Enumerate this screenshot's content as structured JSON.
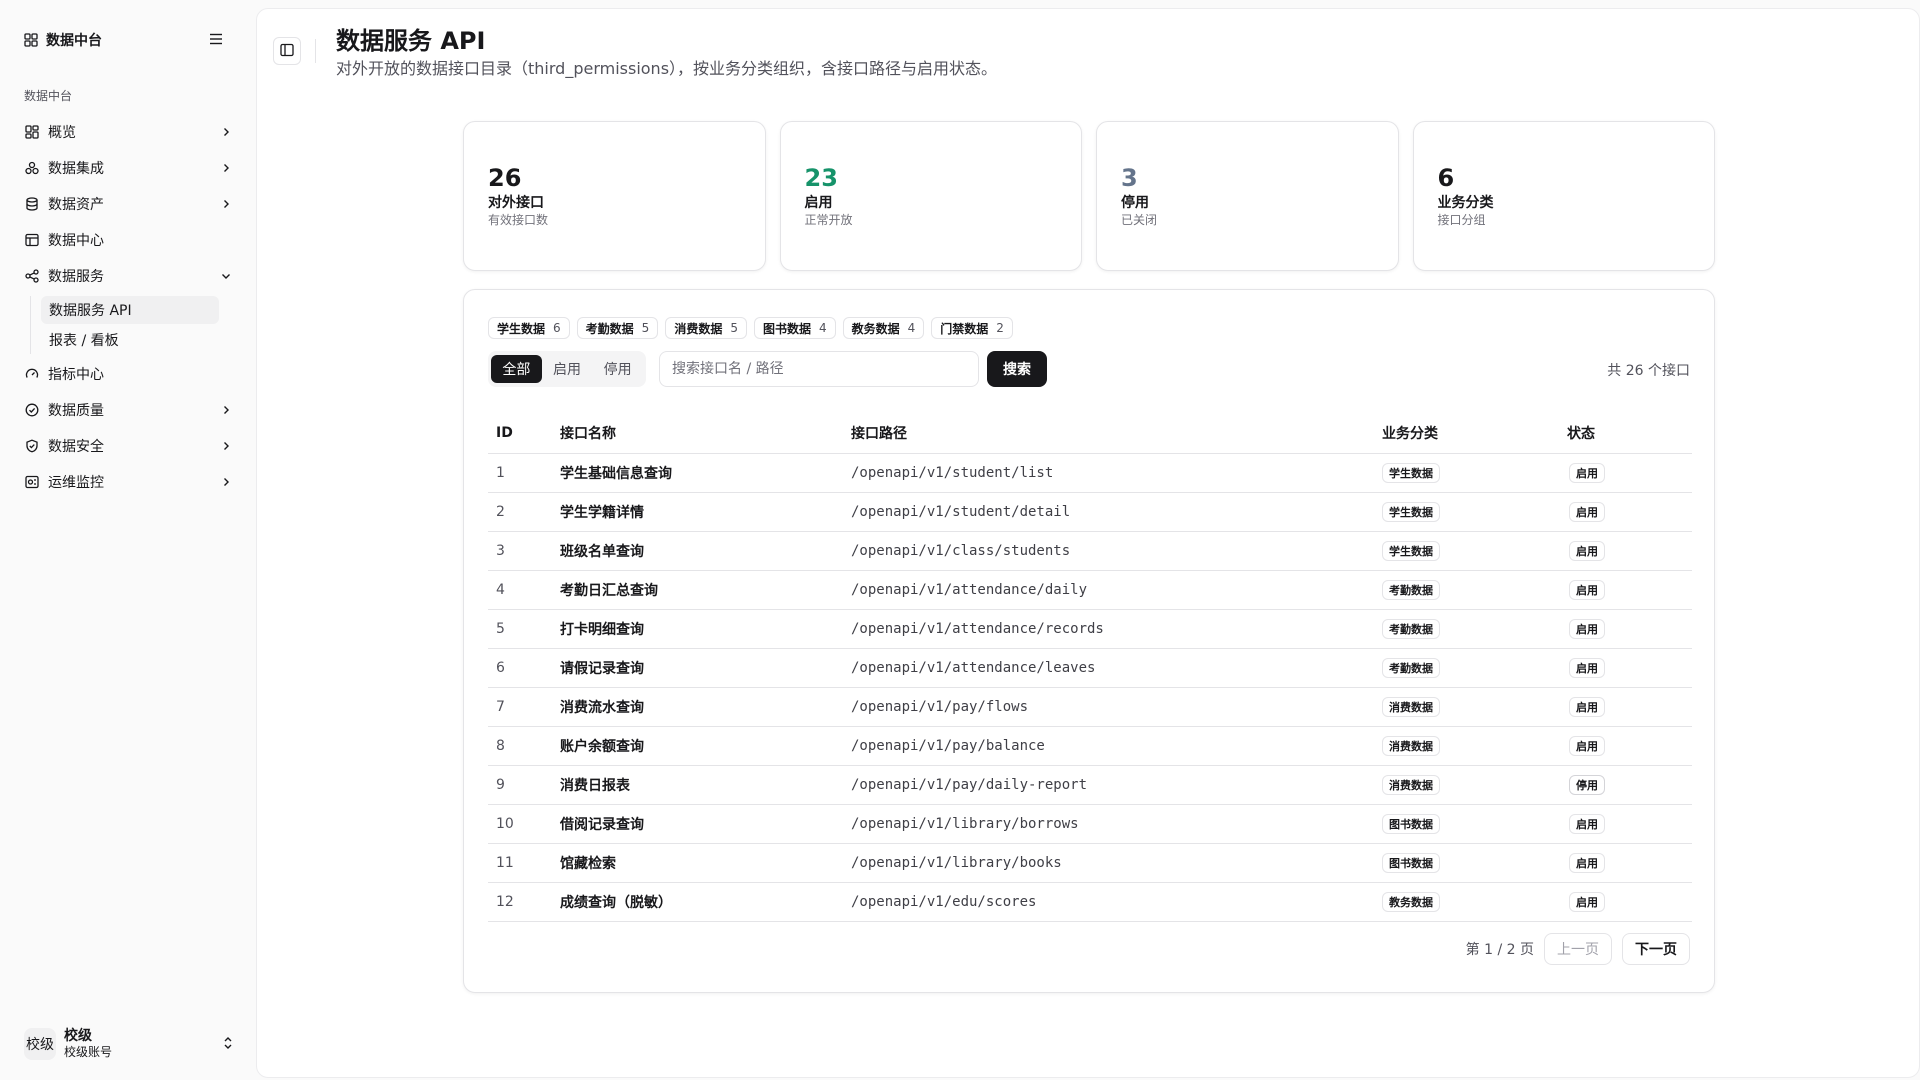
{
  "sidebar": {
    "brand": "数据中台",
    "section_label": "数据中台",
    "items": [
      {
        "label": "概览",
        "icon": "dashboard-icon",
        "has_chevron": true
      },
      {
        "label": "数据集成",
        "icon": "integration-icon",
        "has_chevron": true
      },
      {
        "label": "数据资产",
        "icon": "database-icon",
        "has_chevron": true
      },
      {
        "label": "数据中心",
        "icon": "table-icon",
        "has_chevron": false
      },
      {
        "label": "数据服务",
        "icon": "share-icon",
        "has_chevron": true,
        "expanded": true
      },
      {
        "label": "指标中心",
        "icon": "gauge-icon",
        "has_chevron": false
      },
      {
        "label": "数据质量",
        "icon": "check-circle-icon",
        "has_chevron": true
      },
      {
        "label": "数据安全",
        "icon": "shield-icon",
        "has_chevron": true
      },
      {
        "label": "运维监控",
        "icon": "monitor-icon",
        "has_chevron": true
      }
    ],
    "sub_items": [
      {
        "label": "数据服务 API",
        "active": true
      },
      {
        "label": "报表 / 看板",
        "active": false
      }
    ],
    "user": {
      "avatar": "校级",
      "name": "校级",
      "sub": "校级账号"
    }
  },
  "header": {
    "title": "数据服务 API",
    "description": "对外开放的数据接口目录（third_permissions），按业务分类组织，含接口路径与启用状态。"
  },
  "stats": [
    {
      "value": "26",
      "label": "对外接口",
      "sub": "有效接口数",
      "color": "#18181b"
    },
    {
      "value": "23",
      "label": "启用",
      "sub": "正常开放",
      "color": "#16936a"
    },
    {
      "value": "3",
      "label": "停用",
      "sub": "已关闭",
      "color": "#64748b"
    },
    {
      "value": "6",
      "label": "业务分类",
      "sub": "接口分组",
      "color": "#18181b"
    }
  ],
  "chips": [
    {
      "label": "学生数据",
      "count": "6"
    },
    {
      "label": "考勤数据",
      "count": "5"
    },
    {
      "label": "消费数据",
      "count": "5"
    },
    {
      "label": "图书数据",
      "count": "4"
    },
    {
      "label": "教务数据",
      "count": "4"
    },
    {
      "label": "门禁数据",
      "count": "2"
    }
  ],
  "filter": {
    "segments": [
      "全部",
      "启用",
      "停用"
    ],
    "active_segment": 0,
    "search_placeholder": "搜索接口名 / 路径",
    "search_value": "",
    "search_button": "搜索",
    "total": "共 26 个接口"
  },
  "table": {
    "headers": [
      "ID",
      "接口名称",
      "接口路径",
      "业务分类",
      "状态"
    ],
    "rows": [
      {
        "id": "1",
        "name": "学生基础信息查询",
        "path": "/openapi/v1/student/list",
        "category": "学生数据",
        "status": "启用"
      },
      {
        "id": "2",
        "name": "学生学籍详情",
        "path": "/openapi/v1/student/detail",
        "category": "学生数据",
        "status": "启用"
      },
      {
        "id": "3",
        "name": "班级名单查询",
        "path": "/openapi/v1/class/students",
        "category": "学生数据",
        "status": "启用"
      },
      {
        "id": "4",
        "name": "考勤日汇总查询",
        "path": "/openapi/v1/attendance/daily",
        "category": "考勤数据",
        "status": "启用"
      },
      {
        "id": "5",
        "name": "打卡明细查询",
        "path": "/openapi/v1/attendance/records",
        "category": "考勤数据",
        "status": "启用"
      },
      {
        "id": "6",
        "name": "请假记录查询",
        "path": "/openapi/v1/attendance/leaves",
        "category": "考勤数据",
        "status": "启用"
      },
      {
        "id": "7",
        "name": "消费流水查询",
        "path": "/openapi/v1/pay/flows",
        "category": "消费数据",
        "status": "启用"
      },
      {
        "id": "8",
        "name": "账户余额查询",
        "path": "/openapi/v1/pay/balance",
        "category": "消费数据",
        "status": "启用"
      },
      {
        "id": "9",
        "name": "消费日报表",
        "path": "/openapi/v1/pay/daily-report",
        "category": "消费数据",
        "status": "停用"
      },
      {
        "id": "10",
        "name": "借阅记录查询",
        "path": "/openapi/v1/library/borrows",
        "category": "图书数据",
        "status": "启用"
      },
      {
        "id": "11",
        "name": "馆藏检索",
        "path": "/openapi/v1/library/books",
        "category": "图书数据",
        "status": "启用"
      },
      {
        "id": "12",
        "name": "成绩查询（脱敏）",
        "path": "/openapi/v1/edu/scores",
        "category": "教务数据",
        "status": "启用"
      }
    ]
  },
  "pagination": {
    "text": "第 1 / 2 页",
    "prev": "上一页",
    "next": "下一页"
  }
}
